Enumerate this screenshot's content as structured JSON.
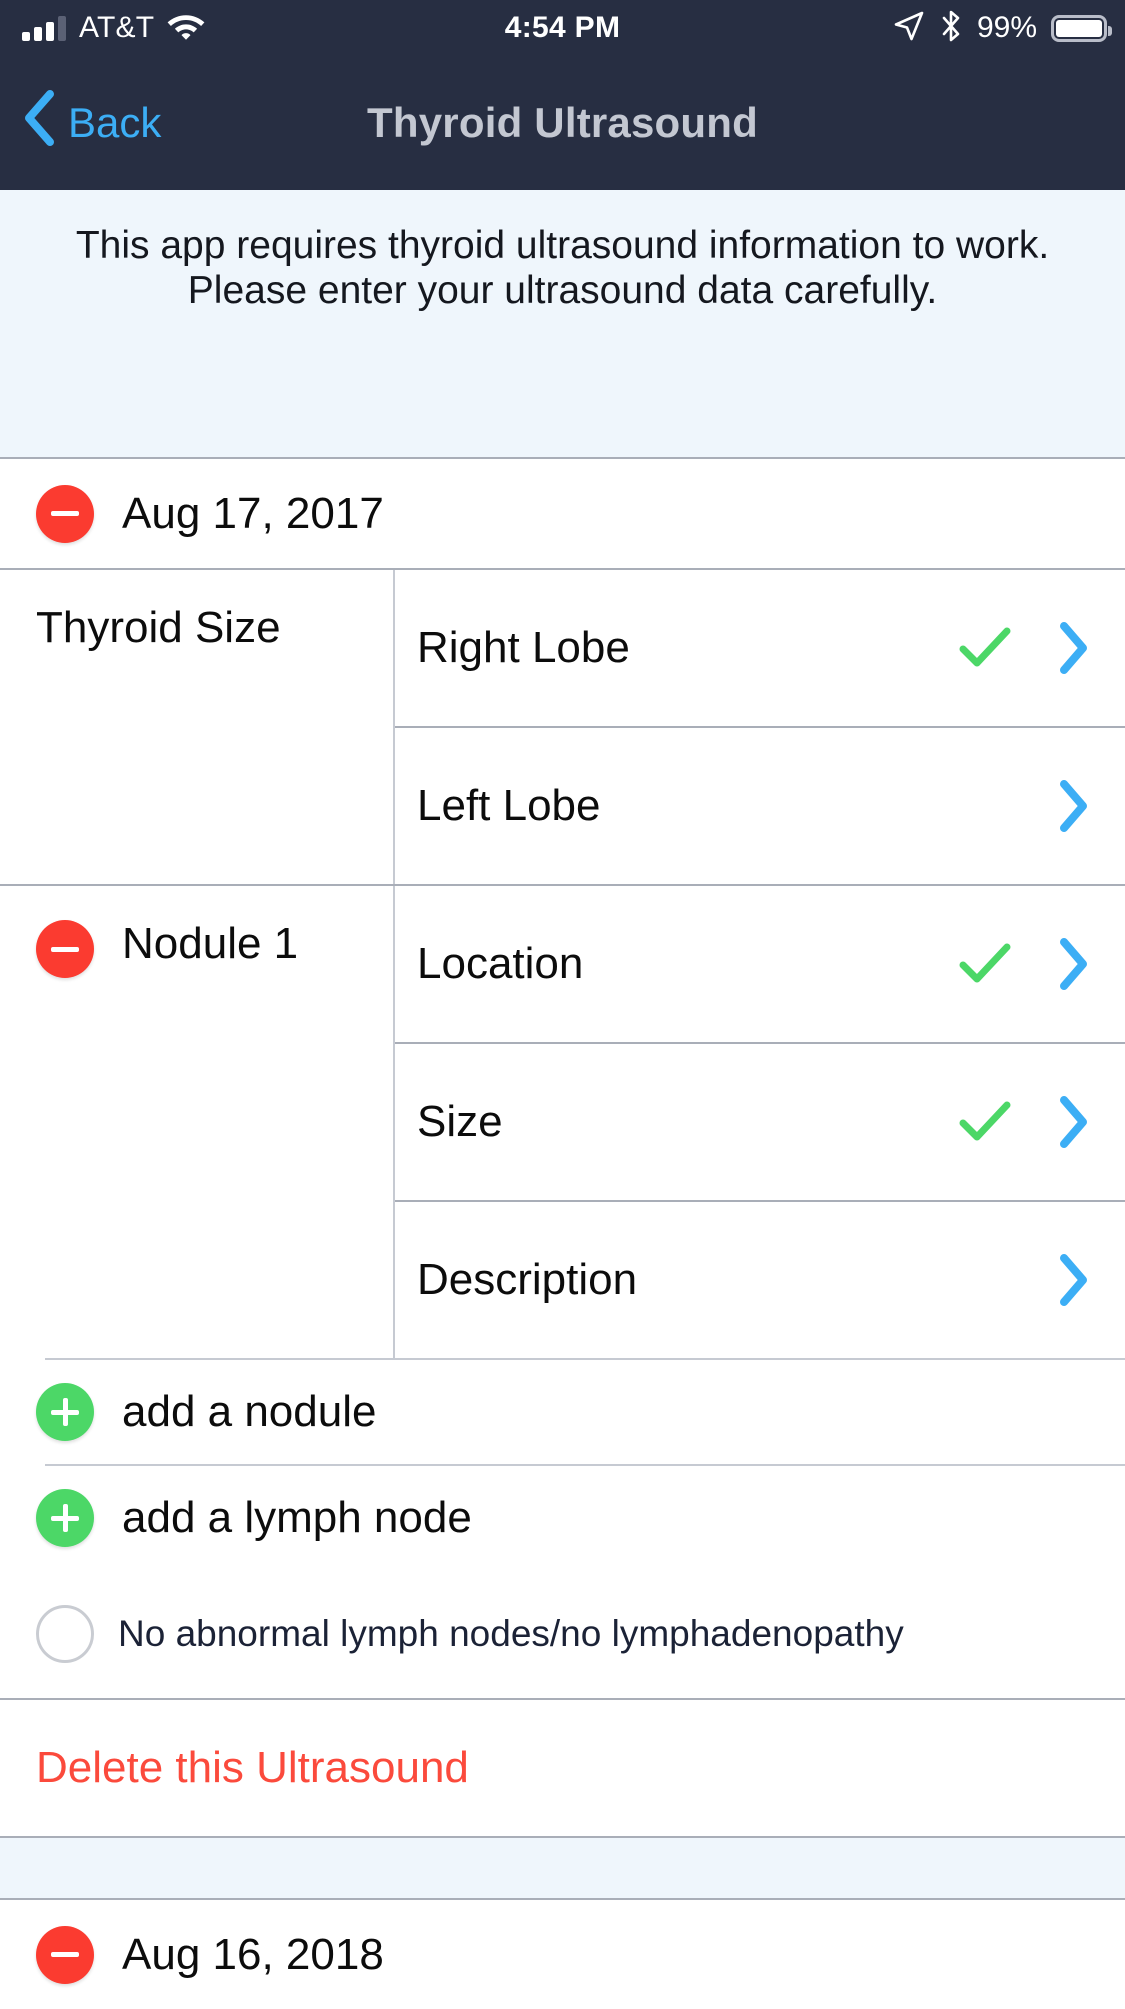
{
  "statusbar": {
    "carrier": "AT&T",
    "time": "4:54 PM",
    "battery_percent": "99%",
    "signal_icon": "cellular-bars-icon",
    "wifi_icon": "wifi-icon",
    "location_icon": "location-arrow-icon",
    "bluetooth_icon": "bluetooth-icon",
    "battery_icon": "battery-full-icon"
  },
  "navbar": {
    "back_label": "Back",
    "title": "Thyroid Ultrasound",
    "back_icon": "chevron-left-icon",
    "back_color": "#3CAEF5",
    "title_color": "#C3C7D1",
    "bg_color": "#272E42"
  },
  "banner": {
    "text": "This app requires thyroid ultrasound information to work. Please enter your ultrasound data carefully.",
    "bg_color": "#EFF6FC"
  },
  "colors": {
    "red": "#FB3B30",
    "green": "#4CD767",
    "blue": "#3CAEF5",
    "delete_red": "#FB4A3C"
  },
  "ultrasounds": [
    {
      "date": "Aug 17, 2017",
      "remove_icon": "minus-circle-icon",
      "sections": [
        {
          "label": "Thyroid Size",
          "has_remove": false,
          "items": [
            {
              "label": "Right Lobe",
              "completed": true,
              "chevron_icon": "chevron-right-icon",
              "check_icon": "checkmark-icon"
            },
            {
              "label": "Left Lobe",
              "completed": false,
              "chevron_icon": "chevron-right-icon",
              "check_icon": "checkmark-icon"
            }
          ]
        },
        {
          "label": "Nodule 1",
          "has_remove": true,
          "remove_icon": "minus-circle-icon",
          "items": [
            {
              "label": "Location",
              "completed": true,
              "chevron_icon": "chevron-right-icon",
              "check_icon": "checkmark-icon"
            },
            {
              "label": "Size",
              "completed": true,
              "chevron_icon": "chevron-right-icon",
              "check_icon": "checkmark-icon"
            },
            {
              "label": "Description",
              "completed": false,
              "chevron_icon": "chevron-right-icon",
              "check_icon": "checkmark-icon"
            }
          ]
        }
      ],
      "add_actions": [
        {
          "label": "add a nodule",
          "icon": "plus-circle-icon"
        },
        {
          "label": "add a lymph node",
          "icon": "plus-circle-icon"
        }
      ],
      "checkbox": {
        "label": "No abnormal lymph nodes/no lymphadenopathy",
        "checked": false,
        "icon": "radio-unchecked-icon"
      },
      "delete_label": "Delete this Ultrasound"
    },
    {
      "date": "Aug 16, 2018",
      "remove_icon": "minus-circle-icon"
    }
  ]
}
